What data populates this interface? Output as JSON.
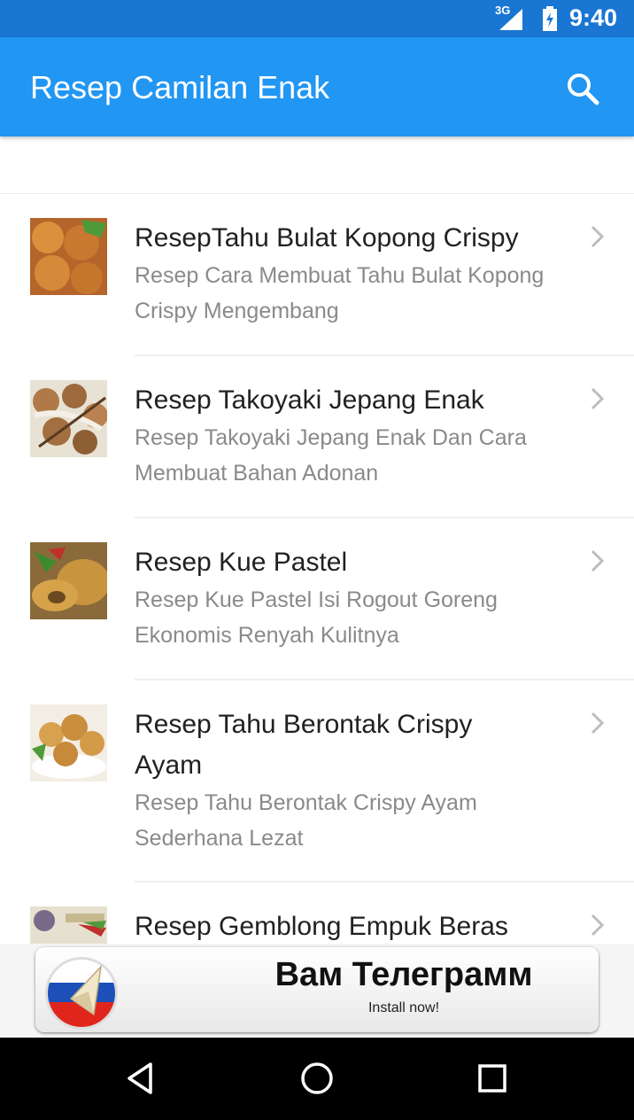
{
  "status_bar": {
    "network": "3G",
    "time": "9:40"
  },
  "app_bar": {
    "title": "Resep Camilan Enak",
    "search_icon": "search-icon",
    "color": "#2196f3"
  },
  "recipes": [
    {
      "title": "ResepTahu Bulat Kopong Crispy",
      "subtitle_line1": "Resep Cara Membuat Tahu Bulat Kopong",
      "subtitle_line2": "Crispy Mengembang"
    },
    {
      "title": "Resep Takoyaki Jepang Enak",
      "subtitle_line1": "Resep Takoyaki Jepang Enak Dan Cara",
      "subtitle_line2": "Membuat Bahan Adonan"
    },
    {
      "title": "Resep Kue Pastel",
      "subtitle_line1": "Resep Kue Pastel Isi Rogout Goreng",
      "subtitle_line2": "Ekonomis Renyah Kulitnya"
    },
    {
      "title_line1": "Resep Tahu Berontak Crispy",
      "title_line2": "Ayam",
      "subtitle_line1": "Resep Tahu Berontak Crispy Ayam",
      "subtitle_line2": "Sederhana Lezat"
    },
    {
      "title": "Resep Gemblong Empuk Beras"
    }
  ],
  "ad": {
    "title": "Вам Телеграмм",
    "subtitle": "Install now!"
  },
  "nav_bar": {
    "back_icon": "back-icon",
    "home_icon": "home-icon",
    "recents_icon": "recents-icon"
  }
}
